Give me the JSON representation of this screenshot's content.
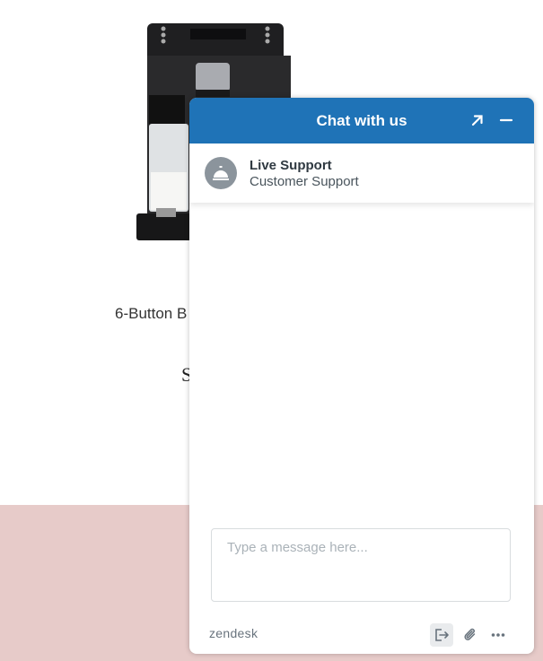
{
  "page": {
    "product_name": "6-Button B",
    "product_price": "S",
    "band_color": "#e7cbc9"
  },
  "chat": {
    "title": "Chat with us",
    "accent": "#1f73b7",
    "popout_icon": "arrow-up-right-icon",
    "minimize_icon": "minus-icon",
    "agent": {
      "name": "Live Support",
      "role": "Customer Support",
      "avatar_icon": "concierge-bell-icon"
    },
    "message_placeholder": "Type a message here...",
    "footer": {
      "brand": "zendesk",
      "end_chat_icon": "end-chat-icon",
      "attach_icon": "paperclip-icon",
      "more_icon": "ellipsis-icon"
    }
  }
}
